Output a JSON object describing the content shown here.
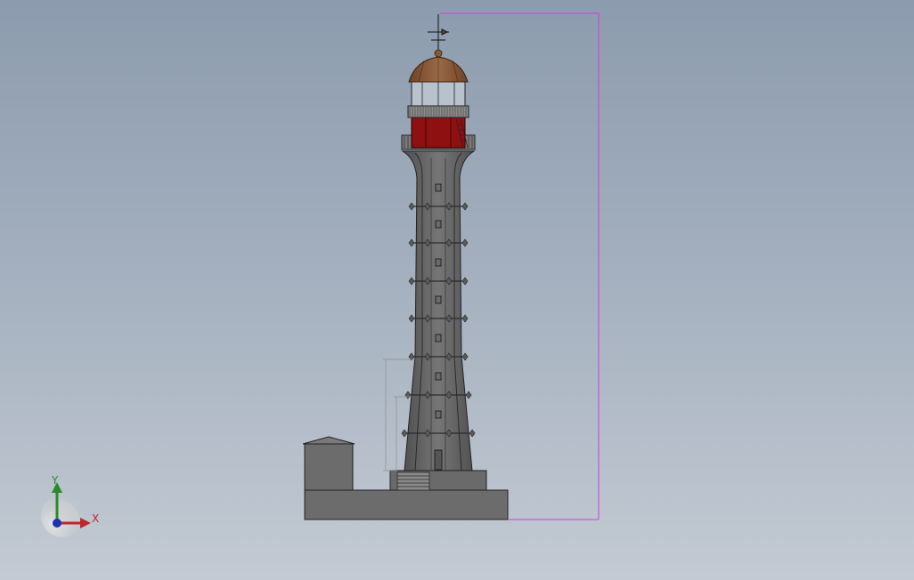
{
  "viewport": {
    "background_top": "#8c9bae",
    "background_bottom": "#c3cad3"
  },
  "model": {
    "colors": {
      "tower": "#6a6a6a",
      "tower_dark": "#3a3a3a",
      "lantern_room": "#8e1010",
      "dome": "#8a5a3a",
      "base": "#6c6c6c",
      "dimension": "#d33bd8",
      "small_dimension": "#9a9a9a"
    },
    "dimensions": {
      "overall_height_text": "",
      "lower_height_text": "",
      "mid_height_text": ""
    }
  },
  "triad": {
    "x_label": "X",
    "y_label": "Y",
    "x_color": "#c0262b",
    "y_color": "#2a8a2a",
    "z_color": "#2030b0"
  }
}
